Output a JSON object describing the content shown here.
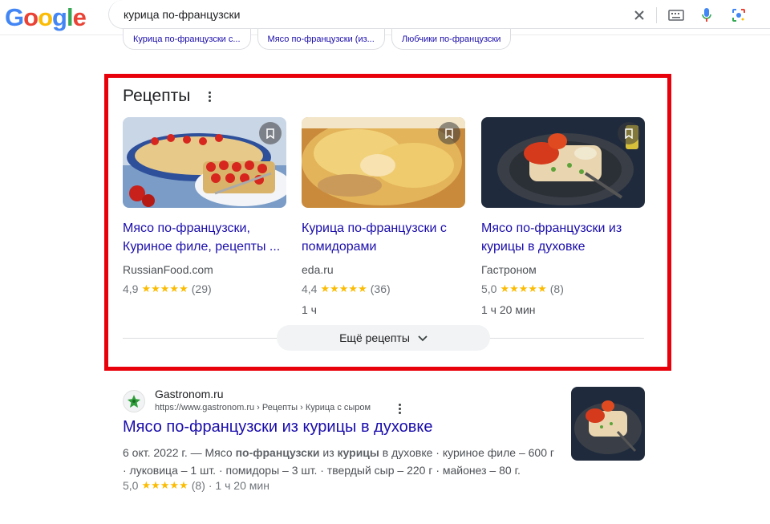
{
  "search": {
    "query": "курица по-французски"
  },
  "logo": {
    "letters": [
      "G",
      "o",
      "o",
      "g",
      "l",
      "e"
    ],
    "colors": [
      "#4285f4",
      "#ea4335",
      "#fbbc05",
      "#4285f4",
      "#34a853",
      "#ea4335"
    ]
  },
  "chips": [
    "Курица по-французски с...",
    "Мясо по-французски (из...",
    "Любчики по-французски"
  ],
  "recipes": {
    "title": "Рецепты",
    "cards": [
      {
        "title": "Мясо по-французски, Куриное филе, рецепты ...",
        "source": "RussianFood.com",
        "rating": "4,9",
        "stars": "★★★★★",
        "count": "(29)",
        "time": ""
      },
      {
        "title": "Курица по-французски с помидорами",
        "source": "eda.ru",
        "rating": "4,4",
        "stars": "★★★★★",
        "count": "(36)",
        "time": "1 ч"
      },
      {
        "title": "Мясо по-французски из курицы в духовке",
        "source": "Гастроном",
        "rating": "5,0",
        "stars": "★★★★★",
        "count": "(8)",
        "time": "1 ч 20 мин"
      }
    ],
    "more_label": "Ещё рецепты"
  },
  "result": {
    "site_name": "Gastronom.ru",
    "url": "https://www.gastronom.ru › Рецепты › Курица с сыром",
    "title": "Мясо по-французски из курицы в духовке",
    "snippet_date": "6 окт. 2022 г. — Мясо ",
    "snippet_b1": "по-французски",
    "snippet_mid": " из ",
    "snippet_b2": "курицы",
    "snippet_rest": " в духовке · куриное филе – 600 г · луковица – 1 шт. · помидоры – 3 шт. · твердый сыр – 220 г · майонез – 80 г.",
    "rating": "5,0",
    "stars": "★★★★★",
    "count": "(8)",
    "time": "· 1 ч 20 мин"
  },
  "colors": {
    "link": "#1a0dab",
    "star": "#fbbc04",
    "highlight": "#e8000b"
  }
}
